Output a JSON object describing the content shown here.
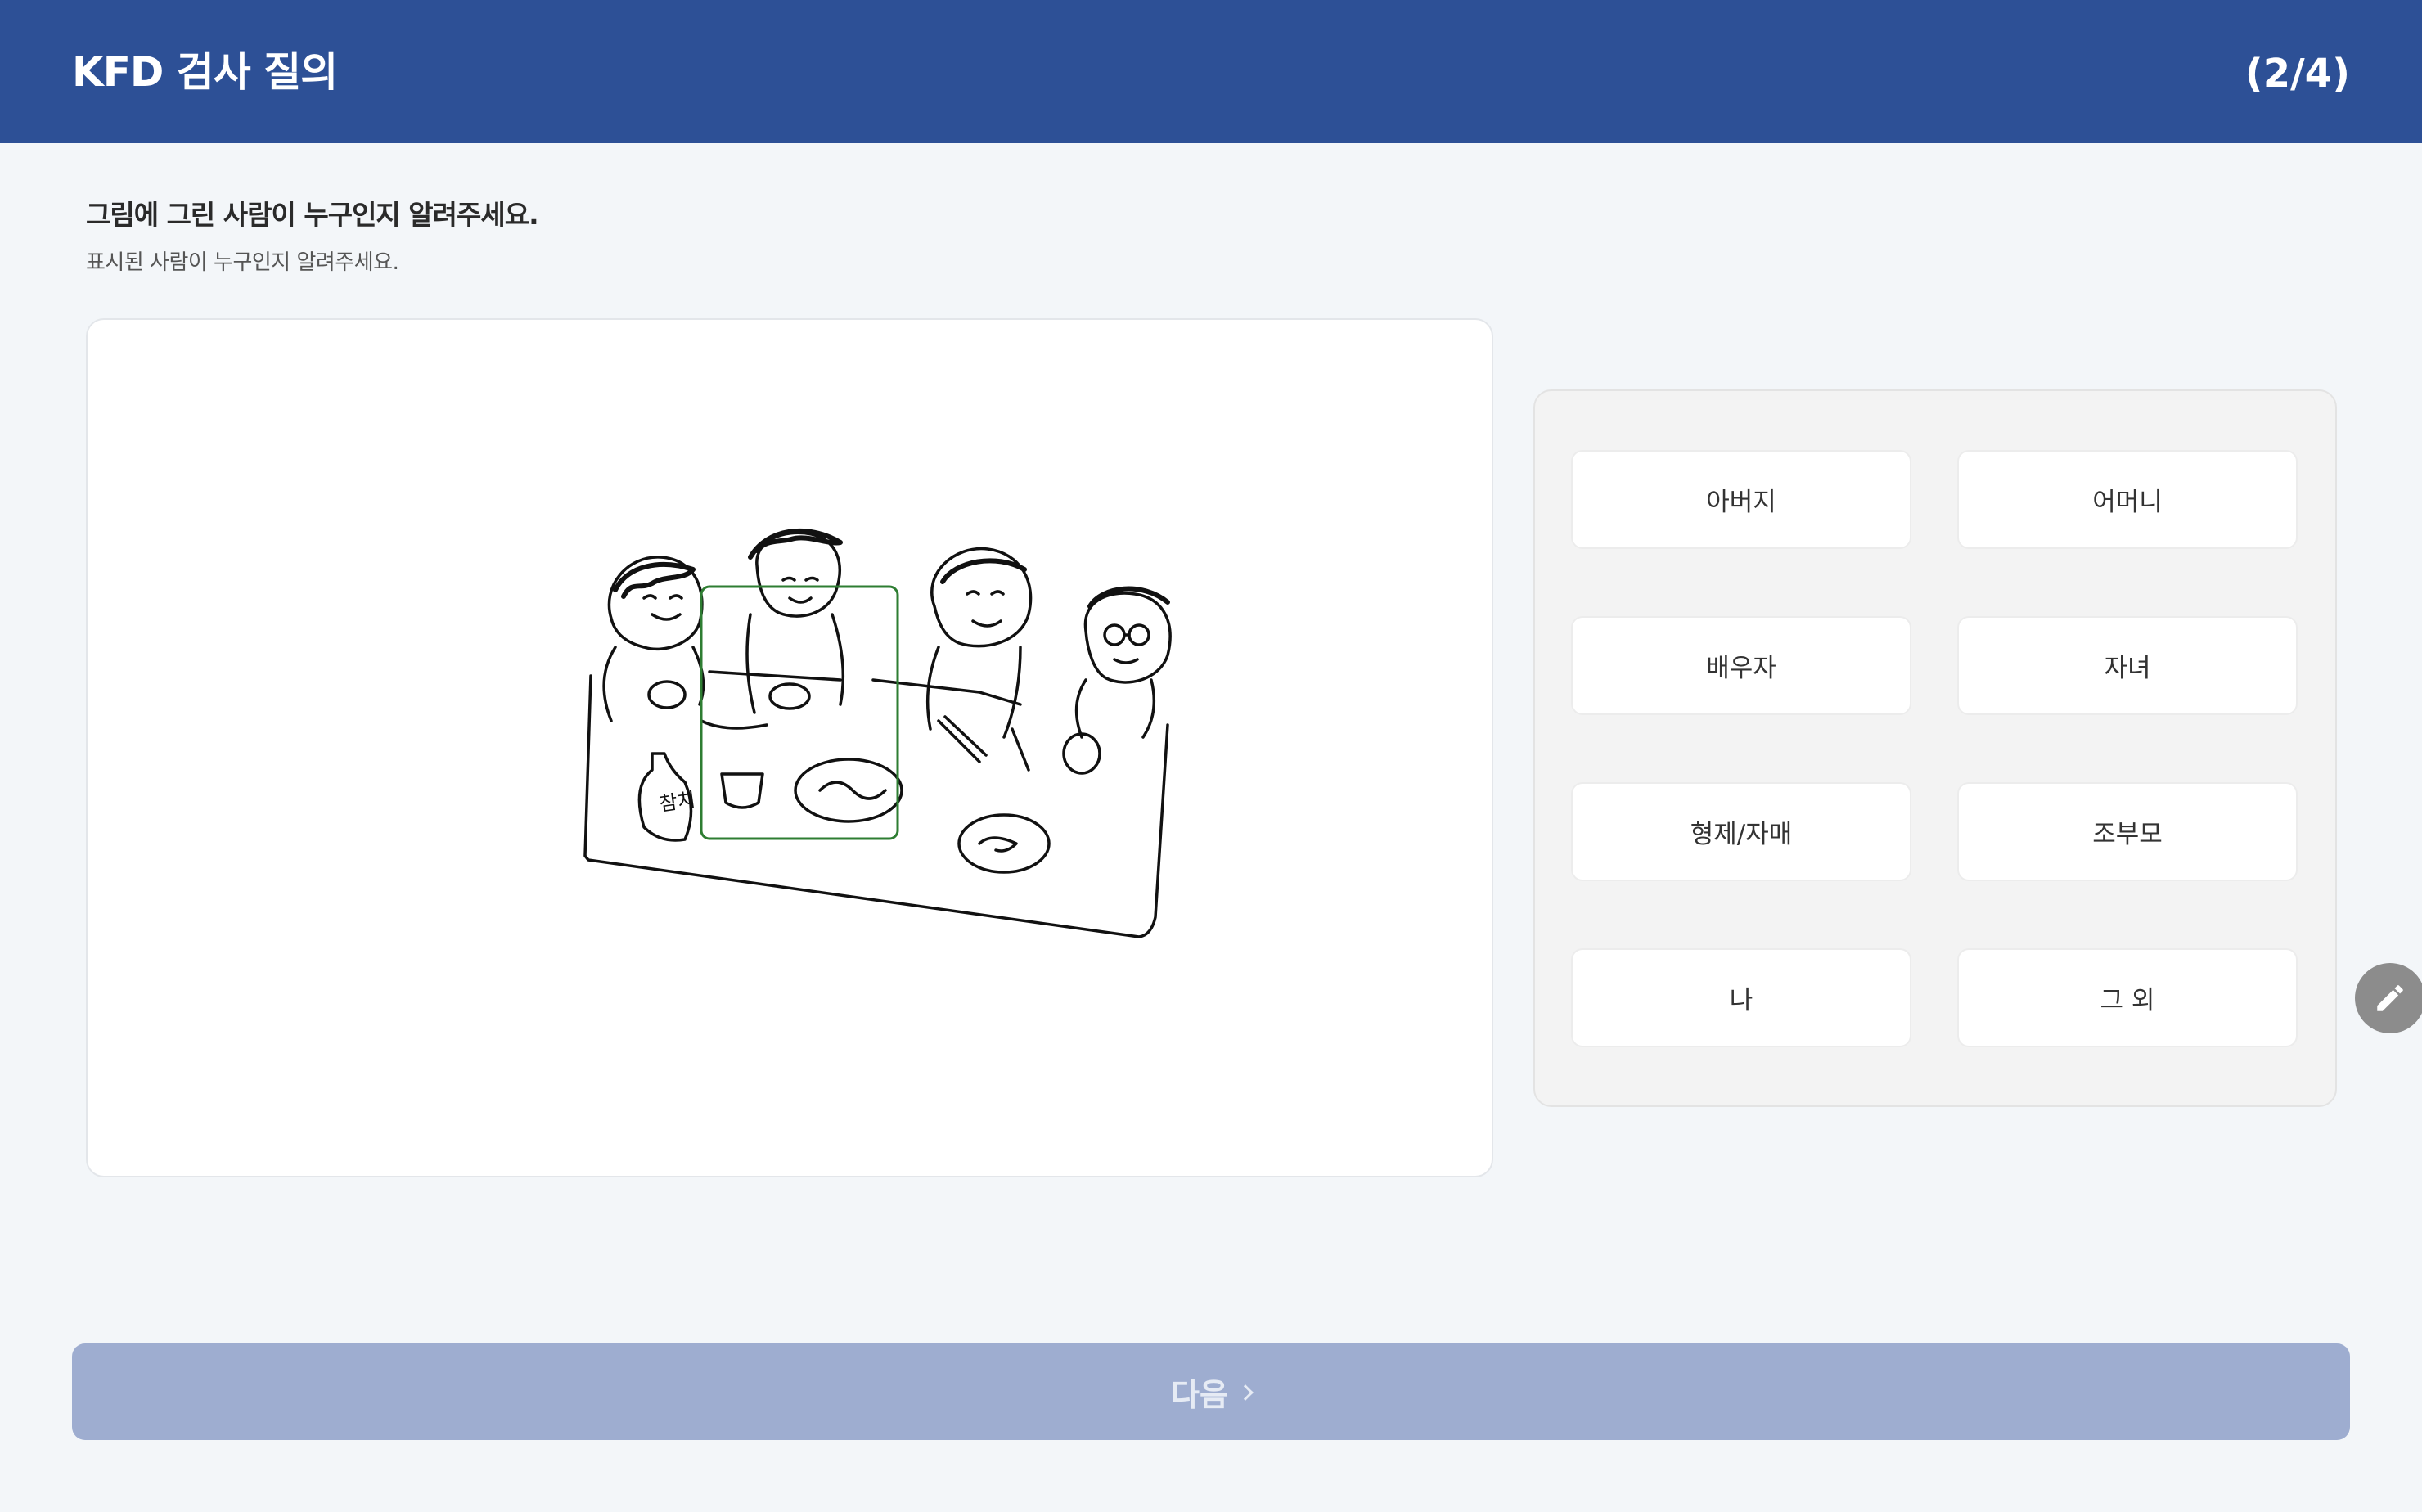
{
  "header": {
    "title": "KFD 검사 질의",
    "progress": "(2/4)"
  },
  "question": {
    "title": "그림에 그린 사람이 누구인지 알려주세요.",
    "subtitle": "표시된 사람이 누구인지 알려주세요."
  },
  "drawing": {
    "bottle_label": "참치",
    "highlight_color": "#2e7d32"
  },
  "options": [
    {
      "label": "아버지"
    },
    {
      "label": "어머니"
    },
    {
      "label": "배우자"
    },
    {
      "label": "자녀"
    },
    {
      "label": "형제/자매"
    },
    {
      "label": "조부모"
    },
    {
      "label": "나"
    },
    {
      "label": "그 외"
    }
  ],
  "footer": {
    "next_label": "다음"
  },
  "colors": {
    "header_bg": "#2d5096",
    "next_disabled_bg": "#9eadd0",
    "page_bg": "#f3f6f9"
  },
  "icons": {
    "edit": "pencil-icon",
    "next": "chevron-right-icon"
  }
}
